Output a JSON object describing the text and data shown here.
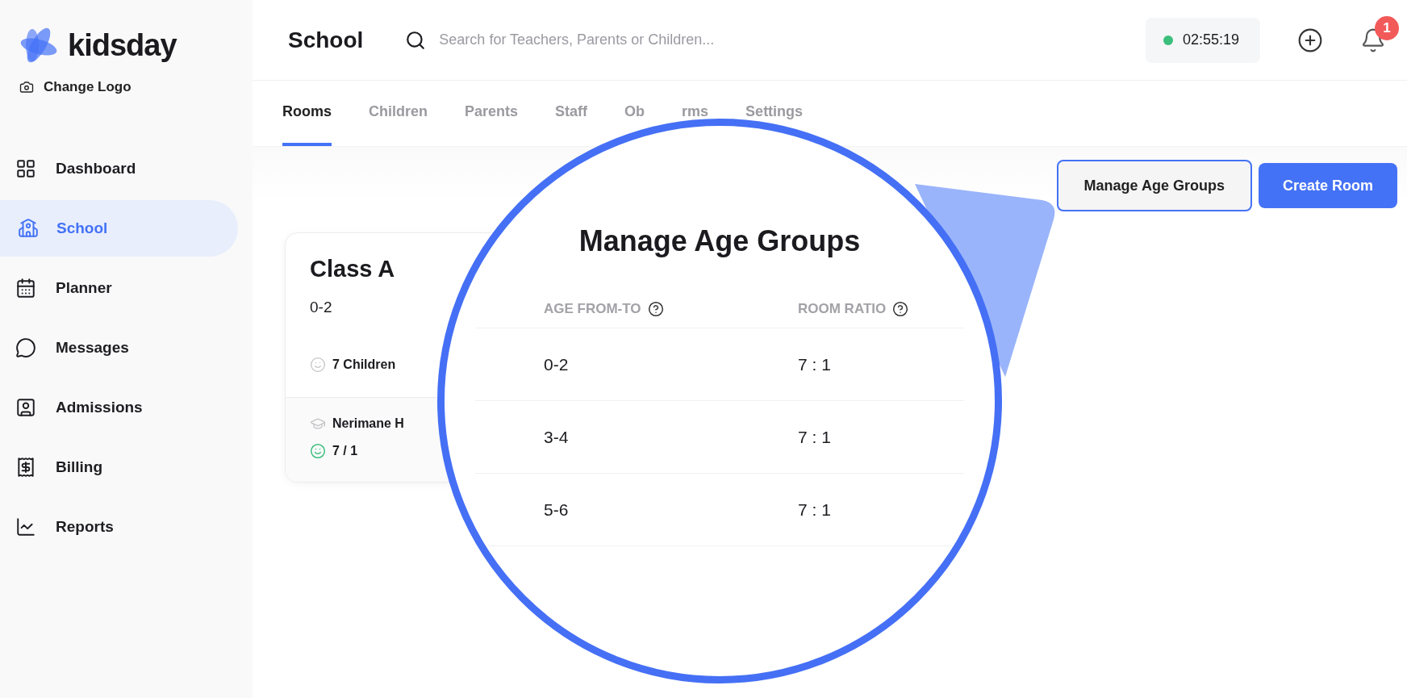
{
  "logo": {
    "name": "kidsday",
    "action": "Change Logo"
  },
  "sidebar": {
    "items": [
      {
        "label": "Dashboard",
        "selected": false
      },
      {
        "label": "School",
        "selected": true
      },
      {
        "label": "Planner",
        "selected": false
      },
      {
        "label": "Messages",
        "selected": false
      },
      {
        "label": "Admissions",
        "selected": false
      },
      {
        "label": "Billing",
        "selected": false
      },
      {
        "label": "Reports",
        "selected": false
      }
    ]
  },
  "header": {
    "title": "School",
    "search": {
      "placeholder": "Search for Teachers, Parents or Children..."
    },
    "timer": "02:55:19",
    "notifications": "1"
  },
  "tabs": [
    {
      "label": "Rooms",
      "selected": true
    },
    {
      "label": "Children",
      "selected": false
    },
    {
      "label": "Parents",
      "selected": false
    },
    {
      "label": "Staff",
      "selected": false
    },
    {
      "label": "Ob",
      "selected": false
    },
    {
      "label": "rms",
      "selected": false
    },
    {
      "label": "Settings",
      "selected": false
    }
  ],
  "actions": [
    {
      "label": "Manage Age Groups",
      "kind": "secondary"
    },
    {
      "label": "Create Room",
      "kind": "primary"
    }
  ],
  "rooms": [
    {
      "name": "Class A",
      "age_range": "0-2",
      "children": "7 Children",
      "teacher": "Nerimane H",
      "ratio": "7 / 1"
    }
  ],
  "magnifier": {
    "title": "Manage Age Groups",
    "columns": [
      "AGE FROM-TO",
      "ROOM RATIO"
    ],
    "rows": [
      [
        "0-2",
        "7 : 1"
      ],
      [
        "3-4",
        "7 : 1"
      ],
      [
        "5-6",
        "7 : 1"
      ]
    ]
  }
}
